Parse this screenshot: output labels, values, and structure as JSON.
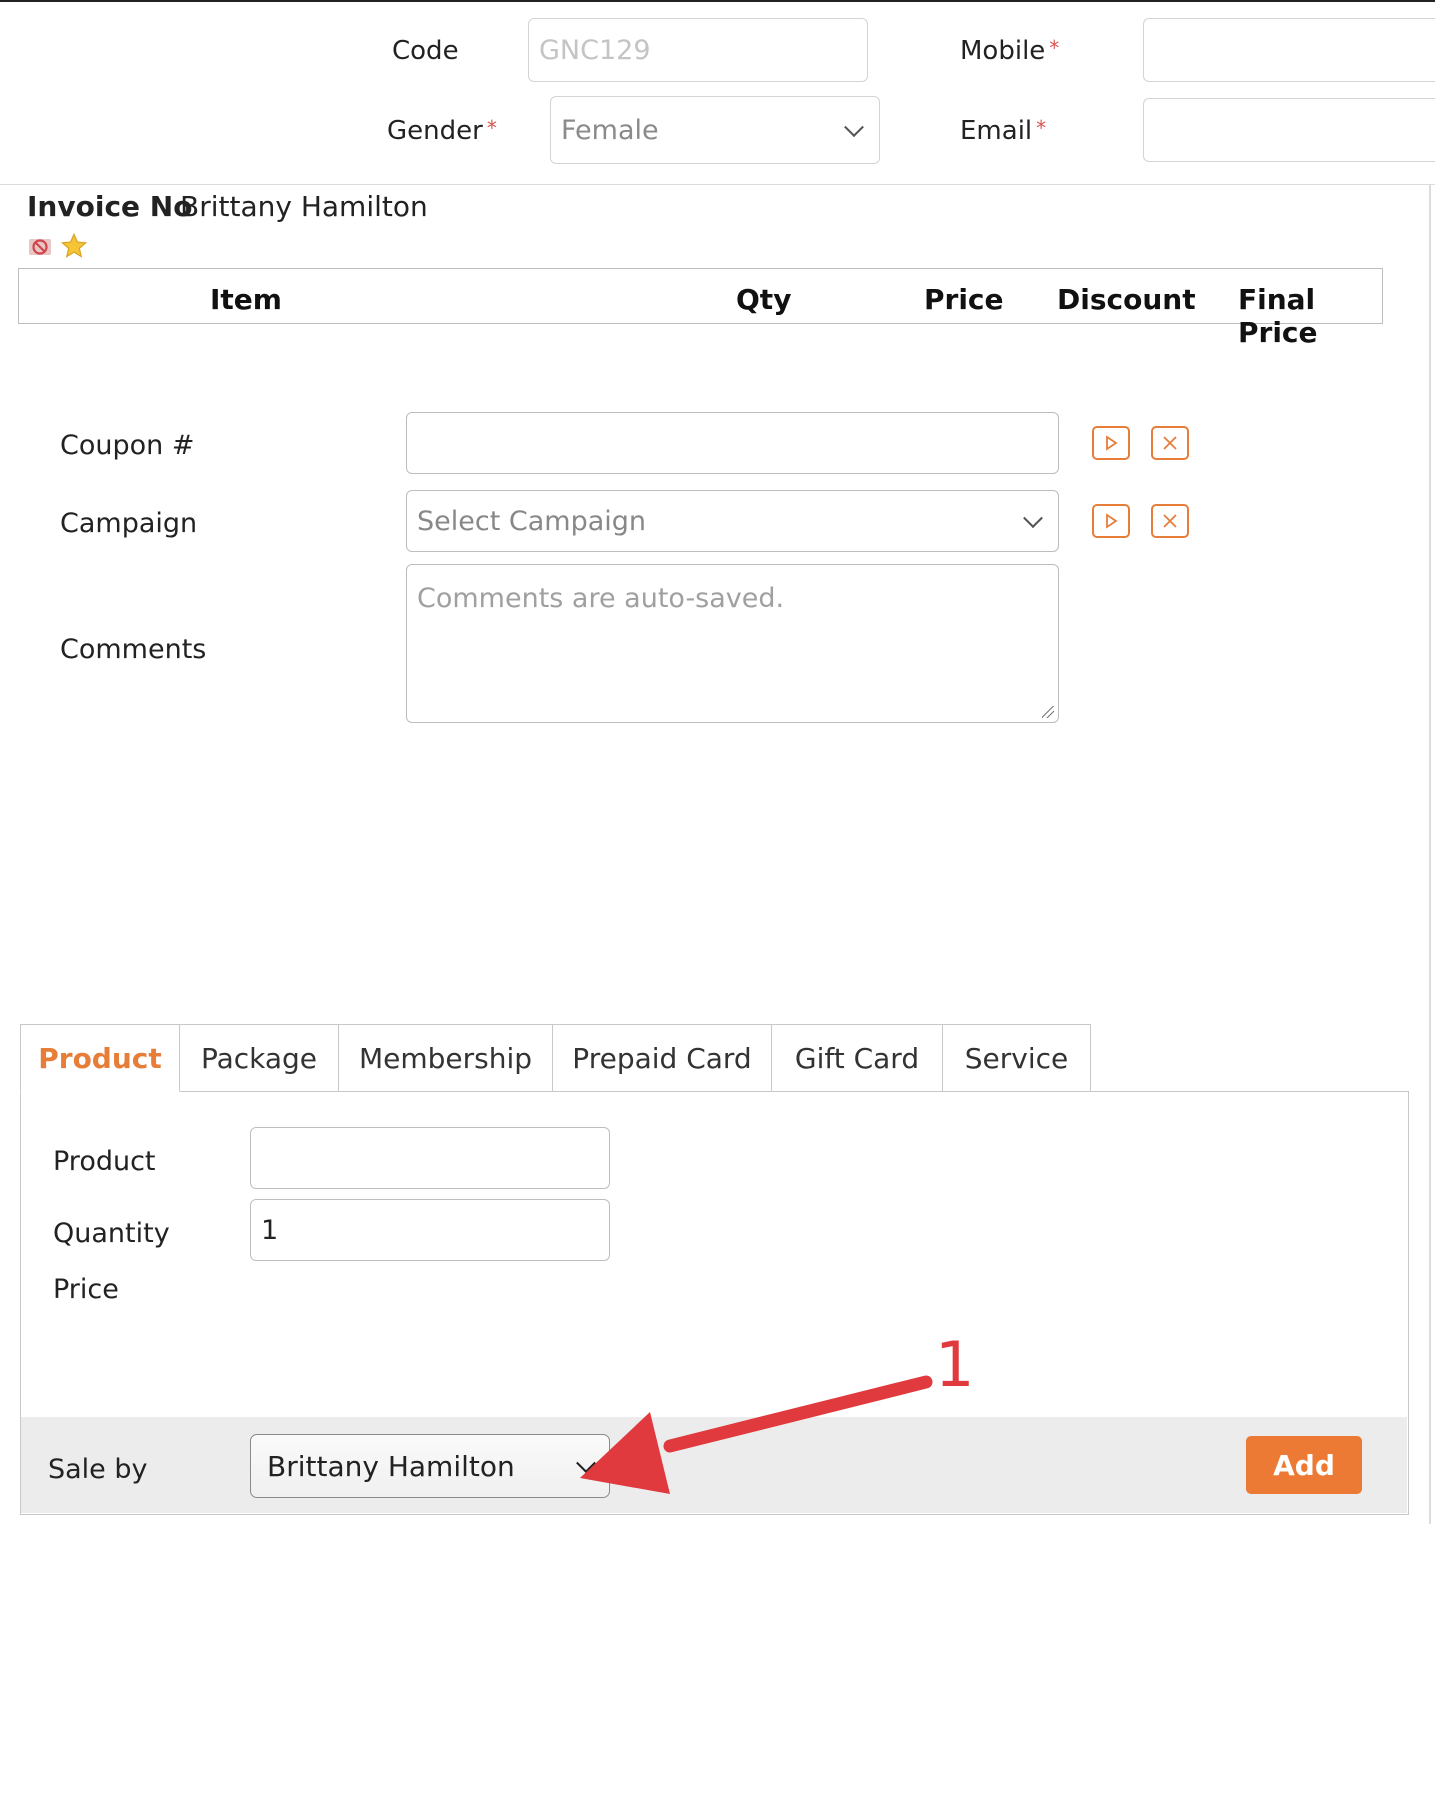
{
  "customer": {
    "code_label": "Code",
    "code_value": "GNC129",
    "mobile_label": "Mobile",
    "gender_label": "Gender",
    "gender_value": "Female",
    "email_label": "Email",
    "required_mark": "*"
  },
  "invoice": {
    "label": "Invoice No",
    "name": "Brittany Hamilton",
    "columns": [
      "Item",
      "Qty",
      "Price",
      "Discount",
      "Final Price"
    ]
  },
  "coupon": {
    "label": "Coupon #"
  },
  "campaign": {
    "label": "Campaign",
    "placeholder": "Select Campaign"
  },
  "comments": {
    "label": "Comments",
    "placeholder": "Comments are auto-saved."
  },
  "tabs": [
    {
      "label": "Product",
      "active": true
    },
    {
      "label": "Package"
    },
    {
      "label": "Membership"
    },
    {
      "label": "Prepaid Card"
    },
    {
      "label": "Gift Card"
    },
    {
      "label": "Service"
    }
  ],
  "product_form": {
    "product_label": "Product",
    "quantity_label": "Quantity",
    "quantity_value": "1",
    "price_label": "Price",
    "sale_by_label": "Sale by",
    "sale_by_value": "Brittany Hamilton",
    "add_label": "Add"
  },
  "annotation": {
    "number": "1",
    "color": "#e0393e"
  },
  "colors": {
    "accent": "#ec7a34",
    "required": "#d9534f"
  }
}
